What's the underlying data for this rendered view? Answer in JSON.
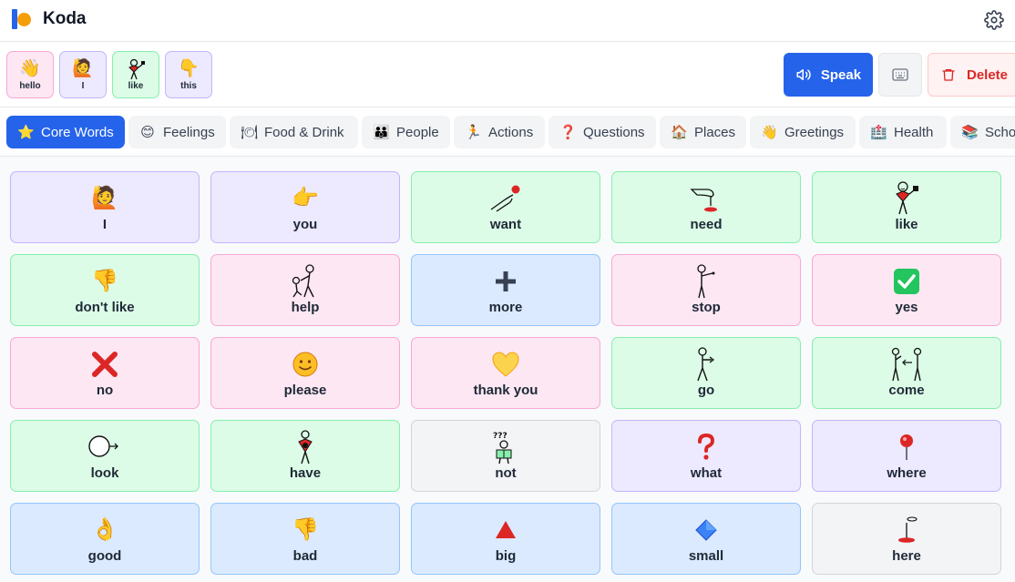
{
  "app": {
    "title": "Koda"
  },
  "sentence": [
    {
      "label": "hello",
      "emoji": "👋",
      "color": "#fce7f3",
      "border": "#f9a8d4"
    },
    {
      "label": "I",
      "emoji": "🙋",
      "color": "#ede9fe",
      "border": "#c4b5fd"
    },
    {
      "label": "like",
      "emoji": "",
      "color": "#dcfce7",
      "border": "#86efac"
    },
    {
      "label": "this",
      "emoji": "👇",
      "color": "#ede9fe",
      "border": "#c4b5fd"
    }
  ],
  "actions": {
    "speak": "Speak",
    "delete": "Delete"
  },
  "tabs": [
    {
      "label": "Core Words",
      "icon": "⭐"
    },
    {
      "label": "Feelings",
      "icon": "😊"
    },
    {
      "label": "Food & Drink",
      "icon": "🍽"
    },
    {
      "label": "People",
      "icon": "👪"
    },
    {
      "label": "Actions",
      "icon": "🏃"
    },
    {
      "label": "Questions",
      "icon": "❓"
    },
    {
      "label": "Places",
      "icon": "🏠"
    },
    {
      "label": "Greetings",
      "icon": "👋"
    },
    {
      "label": "Health",
      "icon": "🏥"
    },
    {
      "label": "School",
      "icon": "📚"
    }
  ],
  "tiles": [
    {
      "word": "I",
      "emoji": "🙋",
      "color": "purple",
      "icon": "person-raising-hand-icon"
    },
    {
      "word": "you",
      "emoji": "👉",
      "color": "purple",
      "icon": "pointing-hand-icon"
    },
    {
      "word": "want",
      "emoji": "",
      "color": "green",
      "icon": "want-hand-icon"
    },
    {
      "word": "need",
      "emoji": "",
      "color": "green",
      "icon": "need-hand-icon"
    },
    {
      "word": "like",
      "emoji": "",
      "color": "green",
      "icon": "like-figure-icon"
    },
    {
      "word": "don't like",
      "emoji": "👎",
      "color": "green",
      "icon": "thumbs-down-icon"
    },
    {
      "word": "help",
      "emoji": "",
      "color": "pink",
      "icon": "help-figure-icon"
    },
    {
      "word": "more",
      "emoji": "➕",
      "color": "blue",
      "icon": "plus-icon"
    },
    {
      "word": "stop",
      "emoji": "",
      "color": "pink",
      "icon": "stop-figure-icon"
    },
    {
      "word": "yes",
      "emoji": "✅",
      "color": "pink",
      "icon": "check-icon"
    },
    {
      "word": "no",
      "emoji": "❌",
      "color": "pink",
      "icon": "cross-icon"
    },
    {
      "word": "please",
      "emoji": "🙂",
      "color": "pink",
      "icon": "smile-icon"
    },
    {
      "word": "thank you",
      "emoji": "💛",
      "color": "pink",
      "icon": "heart-icon"
    },
    {
      "word": "go",
      "emoji": "",
      "color": "green",
      "icon": "go-figure-icon"
    },
    {
      "word": "come",
      "emoji": "",
      "color": "green",
      "icon": "come-figure-icon"
    },
    {
      "word": "look",
      "emoji": "",
      "color": "green",
      "icon": "look-head-icon"
    },
    {
      "word": "have",
      "emoji": "",
      "color": "green",
      "icon": "have-figure-icon"
    },
    {
      "word": "not",
      "emoji": "",
      "color": "gray",
      "icon": "not-figure-icon"
    },
    {
      "word": "what",
      "emoji": "❓",
      "color": "purple",
      "icon": "question-icon"
    },
    {
      "word": "where",
      "emoji": "📍",
      "color": "purple",
      "icon": "pin-icon"
    },
    {
      "word": "good",
      "emoji": "👌",
      "color": "blue",
      "icon": "ok-hand-icon"
    },
    {
      "word": "bad",
      "emoji": "👎",
      "color": "blue",
      "icon": "thumbs-down-icon"
    },
    {
      "word": "big",
      "emoji": "🔺",
      "color": "blue",
      "icon": "triangle-icon"
    },
    {
      "word": "small",
      "emoji": "🔷",
      "color": "blue",
      "icon": "diamond-icon"
    },
    {
      "word": "here",
      "emoji": "",
      "color": "gray",
      "icon": "here-marker-icon"
    }
  ]
}
